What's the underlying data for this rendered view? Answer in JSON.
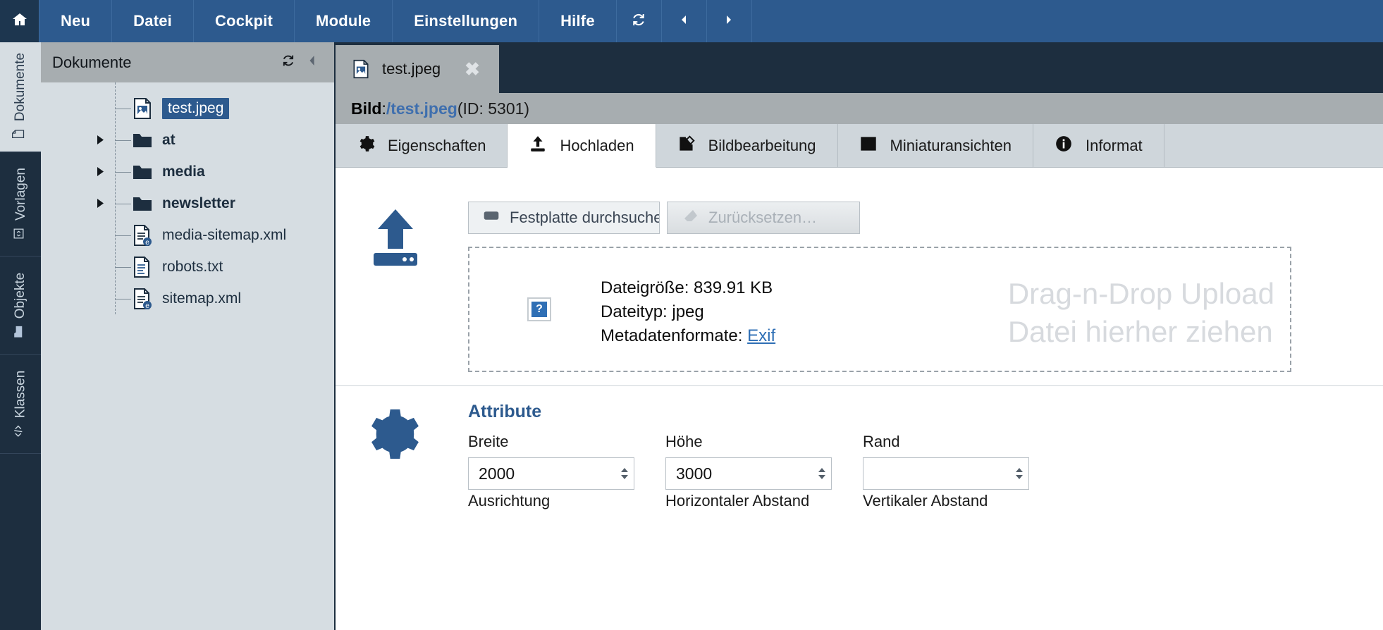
{
  "topbar": {
    "home_icon": "home-icon",
    "menu": [
      {
        "label": "Neu"
      },
      {
        "label": "Datei"
      },
      {
        "label": "Cockpit"
      },
      {
        "label": "Module"
      },
      {
        "label": "Einstellungen"
      },
      {
        "label": "Hilfe"
      }
    ],
    "icons": [
      {
        "name": "refresh-icon"
      },
      {
        "name": "previous-icon"
      },
      {
        "name": "next-icon"
      }
    ]
  },
  "vnav": {
    "items": [
      {
        "label": "Dokumente",
        "icon": "document-icon",
        "active": true
      },
      {
        "label": "Vorlagen",
        "icon": "template-icon",
        "active": false
      },
      {
        "label": "Objekte",
        "icon": "folder-icon",
        "active": false
      },
      {
        "label": "Klassen",
        "icon": "code-icon",
        "active": false
      }
    ]
  },
  "tree": {
    "title": "Dokumente",
    "refresh_icon": "refresh-icon",
    "collapse_icon": "collapse-left-icon",
    "items": [
      {
        "label": "test.jpeg",
        "type": "image",
        "expandable": false,
        "selected": true,
        "bold": false
      },
      {
        "label": "at",
        "type": "folder",
        "expandable": true,
        "selected": false,
        "bold": true
      },
      {
        "label": "media",
        "type": "folder",
        "expandable": true,
        "selected": false,
        "bold": true
      },
      {
        "label": "newsletter",
        "type": "folder",
        "expandable": true,
        "selected": false,
        "bold": true
      },
      {
        "label": "media-sitemap.xml",
        "type": "page",
        "expandable": false,
        "selected": false,
        "bold": false
      },
      {
        "label": "robots.txt",
        "type": "text",
        "expandable": false,
        "selected": false,
        "bold": false
      },
      {
        "label": "sitemap.xml",
        "type": "page",
        "expandable": false,
        "selected": false,
        "bold": false
      }
    ]
  },
  "doc_tab": {
    "label": "test.jpeg",
    "icon": "image-file-icon",
    "close_label": "✖"
  },
  "breadcrumb": {
    "prefix": "Bild",
    "separator": ": ",
    "path": "/test.jpeg",
    "id_text": " (ID: 5301)"
  },
  "tabs": [
    {
      "label": "Eigenschaften",
      "icon": "gear-icon",
      "active": false
    },
    {
      "label": "Hochladen",
      "icon": "upload-icon",
      "active": true
    },
    {
      "label": "Bildbearbeitung",
      "icon": "pencil-edit-icon",
      "active": false
    },
    {
      "label": "Miniaturansichten",
      "icon": "image-icon",
      "active": false
    },
    {
      "label": "Informat",
      "icon": "info-icon",
      "active": false
    }
  ],
  "upload": {
    "big_icon": "upload-cloud-icon",
    "browse_button": "Festplatte durchsuchen",
    "browse_icon": "harddisk-icon",
    "reset_button": "Zurücksetzen…",
    "reset_icon": "eraser-icon",
    "help_icon": "question-mark-icon",
    "filesize_label": "Dateigröße: 839.91 KB",
    "filetype_label": "Dateityp: jpeg",
    "metadata_label": "Metadatenformate: ",
    "metadata_link": "Exif",
    "ghost_line1": "Drag-n-Drop Upload",
    "ghost_line2": "Datei hierher ziehen"
  },
  "attributes": {
    "icon": "gear-icon",
    "title": "Attribute",
    "fields": [
      {
        "label": "Breite",
        "value": "2000",
        "has_spinner": true
      },
      {
        "label": "Höhe",
        "value": "3000",
        "has_spinner": true
      },
      {
        "label": "Rand",
        "value": "",
        "has_spinner": true
      }
    ],
    "row2": [
      {
        "label": "Ausrichtung"
      },
      {
        "label": "Horizontaler Abstand"
      },
      {
        "label": "Vertikaler Abstand"
      }
    ]
  },
  "colors": {
    "brand_blue": "#2d5a8e",
    "dark_navy": "#1d2e3f",
    "panel_grey": "#d6dde2",
    "header_grey": "#a7adb0",
    "link_blue": "#3f6fae"
  }
}
